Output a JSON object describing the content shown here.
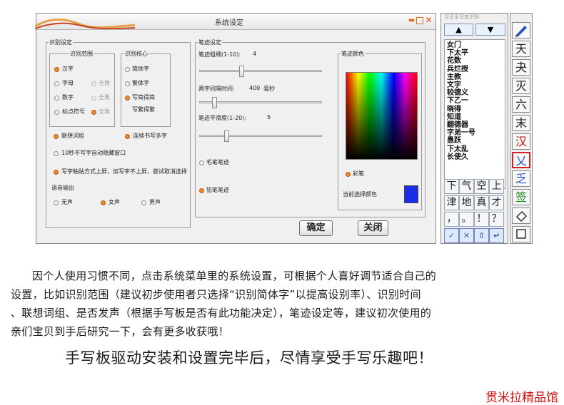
{
  "dialog": {
    "title": "系统设定",
    "recog_group": "识别设定",
    "range_group": "识别范围",
    "core_group": "识别核心",
    "range_options": [
      "汉字",
      "字母",
      "数字",
      "标点符号"
    ],
    "range_sub": [
      "全角",
      "全角",
      "全角"
    ],
    "core_options": [
      "简体字",
      "繁体字",
      "写简得简",
      "写繁得繁"
    ],
    "assoc_label": "联想词组",
    "continuous_label": "连续书写多字",
    "autohide_label": "10秒不写字自动隐藏窗口",
    "paste_label": "写字粘贴方式上屏，加写字不上屏，尝试取消选择",
    "voice_label": "语音输出",
    "voice_options": [
      "无声",
      "女声",
      "男声"
    ],
    "stroke_group": "笔迹设定",
    "thickness_label": "笔迹粗细(1-10):",
    "thickness_value": "4",
    "interval_label": "两字间隔时间:",
    "interval_value": "400",
    "interval_unit": "毫秒",
    "smooth_label": "笔迹平滑度(1-20):",
    "smooth_value": "5",
    "brush_label": "毛笔笔迹",
    "pencil_label": "铅笔笔迹",
    "color_group": "笔迹颜色",
    "rainbow_label": "彩笔",
    "current_color_label": "当前选择颜色",
    "current_color": "#1a2ee8",
    "ok_label": "确定",
    "close_label": "关闭"
  },
  "pad": {
    "title": "汉王手写笔识别",
    "up_arrow": "▲",
    "down_arrow": "▼",
    "candidates": [
      "女门",
      "下太平",
      "花数",
      "兵烂授",
      "主教",
      "文字",
      "较德义",
      "下乙一",
      "晓得",
      "知道",
      "翻德器",
      "字弟一号",
      "愚跃",
      "下太乱",
      "长使久"
    ],
    "keys": [
      "下",
      "气",
      "空",
      "上",
      "津",
      "地",
      "真",
      "才",
      "，",
      "。",
      "！",
      "？"
    ],
    "bottom_keys": [
      "✓",
      "✕",
      "⇧",
      "↵"
    ]
  },
  "toolbar": {
    "icons": [
      "pen-icon",
      "eraser-icon"
    ],
    "chars": [
      "天",
      "夬",
      "灭",
      "六",
      "末",
      "汉",
      "乂",
      "乏",
      "签"
    ]
  },
  "caption": {
    "paragraph_lines": [
      "因个人使用习惯不同，点击系统菜单里的系统设置，可根据个人喜好调节适合自己的",
      "设置，比如识别范围（建议初步使用者只选择“识别简体字”以提高设别率）、识别时间",
      "、联想词组、是否发声（根据手写板是否有此功能决定），笔迹设定等，建议初次使用的",
      "亲们宝贝到手后研究一下，会有更多收获哦！"
    ],
    "slogan": "手写板驱动安装和设置完毕后，尽情享受手写乐趣吧！",
    "brand": "贯米拉精品馆"
  },
  "colors": {
    "radio_on": "#ef8a2a",
    "brand_red": "#d01010",
    "toolbar_highlight": "#d42020"
  }
}
